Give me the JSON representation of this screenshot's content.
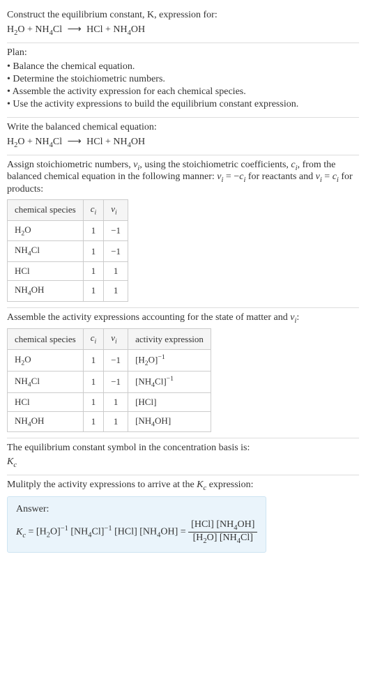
{
  "intro": {
    "line1": "Construct the equilibrium constant, K, expression for:",
    "equation_html": "H<sub>2</sub>O + NH<sub>4</sub>Cl <span class='arrow'>⟶</span> HCl + NH<sub>4</sub>OH"
  },
  "plan": {
    "heading": "Plan:",
    "items": [
      "• Balance the chemical equation.",
      "• Determine the stoichiometric numbers.",
      "• Assemble the activity expression for each chemical species.",
      "• Use the activity expressions to build the equilibrium constant expression."
    ]
  },
  "balanced": {
    "heading": "Write the balanced chemical equation:",
    "equation_html": "H<sub>2</sub>O + NH<sub>4</sub>Cl <span class='arrow'>⟶</span> HCl + NH<sub>4</sub>OH"
  },
  "stoich": {
    "heading_html": "Assign stoichiometric numbers, <span class='italic'>ν<sub>i</sub></span>, using the stoichiometric coefficients, <span class='italic'>c<sub>i</sub></span>, from the balanced chemical equation in the following manner: <span class='italic'>ν<sub>i</sub></span> = −<span class='italic'>c<sub>i</sub></span> for reactants and <span class='italic'>ν<sub>i</sub></span> = <span class='italic'>c<sub>i</sub></span> for products:",
    "headers": [
      "chemical species",
      "c_i",
      "ν_i"
    ],
    "rows": [
      {
        "species_html": "H<sub>2</sub>O",
        "c": "1",
        "v": "−1"
      },
      {
        "species_html": "NH<sub>4</sub>Cl",
        "c": "1",
        "v": "−1"
      },
      {
        "species_html": "HCl",
        "c": "1",
        "v": "1"
      },
      {
        "species_html": "NH<sub>4</sub>OH",
        "c": "1",
        "v": "1"
      }
    ]
  },
  "activity": {
    "heading_html": "Assemble the activity expressions accounting for the state of matter and <span class='italic'>ν<sub>i</sub></span>:",
    "headers": [
      "chemical species",
      "c_i",
      "ν_i",
      "activity expression"
    ],
    "rows": [
      {
        "species_html": "H<sub>2</sub>O",
        "c": "1",
        "v": "−1",
        "activity_html": "[H<sub>2</sub>O]<sup>−1</sup>"
      },
      {
        "species_html": "NH<sub>4</sub>Cl",
        "c": "1",
        "v": "−1",
        "activity_html": "[NH<sub>4</sub>Cl]<sup>−1</sup>"
      },
      {
        "species_html": "HCl",
        "c": "1",
        "v": "1",
        "activity_html": "[HCl]"
      },
      {
        "species_html": "NH<sub>4</sub>OH",
        "c": "1",
        "v": "1",
        "activity_html": "[NH<sub>4</sub>OH]"
      }
    ]
  },
  "symbol": {
    "heading": "The equilibrium constant symbol in the concentration basis is:",
    "value_html": "<span class='italic'>K<sub>c</sub></span>"
  },
  "multiply": {
    "heading_html": "Mulitply the activity expressions to arrive at the <span class='italic'>K<sub>c</sub></span> expression:"
  },
  "answer": {
    "label": "Answer:",
    "expr_html": "<span class='italic'>K<sub>c</sub></span> = [H<sub>2</sub>O]<sup>−1</sup> [NH<sub>4</sub>Cl]<sup>−1</sup> [HCl] [NH<sub>4</sub>OH] = <span class='frac'><span class='num'>[HCl] [NH<sub>4</sub>OH]</span><span class='den'>[H<sub>2</sub>O] [NH<sub>4</sub>Cl]</span></span>"
  },
  "chart_data": {
    "type": "table",
    "tables": [
      {
        "title": "Stoichiometric numbers",
        "columns": [
          "chemical species",
          "c_i",
          "ν_i"
        ],
        "rows": [
          [
            "H2O",
            1,
            -1
          ],
          [
            "NH4Cl",
            1,
            -1
          ],
          [
            "HCl",
            1,
            1
          ],
          [
            "NH4OH",
            1,
            1
          ]
        ]
      },
      {
        "title": "Activity expressions",
        "columns": [
          "chemical species",
          "c_i",
          "ν_i",
          "activity expression"
        ],
        "rows": [
          [
            "H2O",
            1,
            -1,
            "[H2O]^-1"
          ],
          [
            "NH4Cl",
            1,
            -1,
            "[NH4Cl]^-1"
          ],
          [
            "HCl",
            1,
            1,
            "[HCl]"
          ],
          [
            "NH4OH",
            1,
            1,
            "[NH4OH]"
          ]
        ]
      }
    ]
  }
}
